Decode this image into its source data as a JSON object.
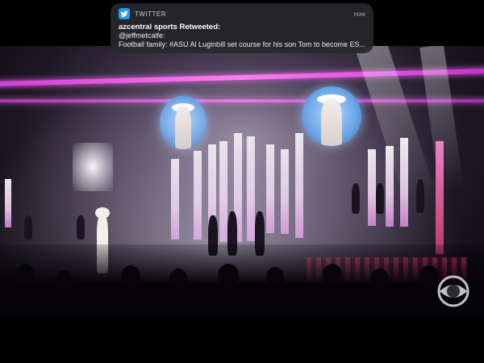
{
  "notification": {
    "app_name": "TWITTER",
    "app_icon": "twitter-bird-icon",
    "time": "now",
    "title": "azcentral sports Retweeted:",
    "handle": "@jeffmetcalfe:",
    "message": "Football family: #ASU Al Luginbill set course for his son Tom to become ES..."
  },
  "video": {
    "watermark": "cbs-eye-logo",
    "colors": {
      "truss": "#e24fe6",
      "screen": "#7fb3f0",
      "stage": "#e23c6f"
    }
  }
}
